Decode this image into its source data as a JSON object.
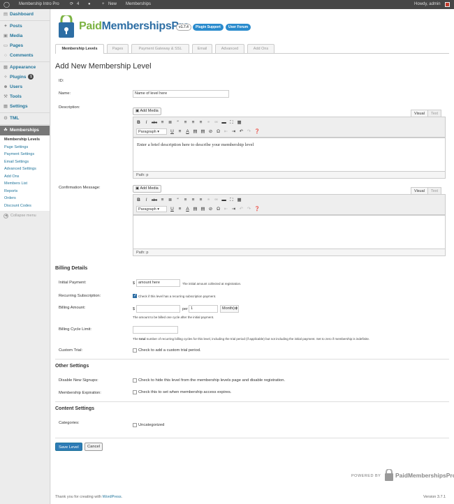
{
  "admin_bar": {
    "site_name": "Membership Intro Pro",
    "updates_count": "4",
    "new_label": "New",
    "memberships_label": "Memberships",
    "howdy": "Howdy, admin"
  },
  "sidebar": {
    "items": [
      {
        "label": "Dashboard",
        "icon": "dashboard-icon"
      },
      {
        "label": "Posts",
        "icon": "pin-icon"
      },
      {
        "label": "Media",
        "icon": "media-icon"
      },
      {
        "label": "Pages",
        "icon": "page-icon"
      },
      {
        "label": "Comments",
        "icon": "comment-icon"
      },
      {
        "label": "Appearance",
        "icon": "appearance-icon"
      },
      {
        "label": "Plugins",
        "icon": "plugin-icon",
        "badge": "1"
      },
      {
        "label": "Users",
        "icon": "users-icon"
      },
      {
        "label": "Tools",
        "icon": "tools-icon"
      },
      {
        "label": "Settings",
        "icon": "settings-icon"
      },
      {
        "label": "TML",
        "icon": "tml-icon"
      },
      {
        "label": "Memberships",
        "icon": "memberships-icon"
      }
    ],
    "sub_items": [
      "Membership Levels",
      "Page Settings",
      "Payment Settings",
      "Email Settings",
      "Advanced Settings",
      "Add Ons",
      "Members List",
      "Reports",
      "Orders",
      "Discount Codes"
    ],
    "collapse_label": "Collapse menu"
  },
  "brand": {
    "logo_text": "PaidMembershipsPro",
    "version": "v1.7.4",
    "support_label": "Plugin Support",
    "forum_label": "User Forum"
  },
  "tabs": [
    "Membership Levels",
    "Pages",
    "Payment Gateway & SSL",
    "Email",
    "Advanced",
    "Add Ons"
  ],
  "page_title": "Add New Membership Level",
  "fields": {
    "id_label": "ID:",
    "name_label": "Name:",
    "name_placeholder": "Name of level here",
    "description_label": "Description:",
    "add_media": "Add Media",
    "visual_tab": "Visual",
    "text_tab": "Text",
    "format_select": "Paragraph",
    "description_text": "Enter a brief description here to describe your membership level",
    "path_label": "Path: p",
    "confirmation_label": "Confirmation Message:"
  },
  "billing": {
    "heading": "Billing Details",
    "initial_payment_label": "Initial Payment:",
    "currency": "$",
    "initial_payment_value": "amount here",
    "initial_payment_hint": "The initial amount collected at registration.",
    "recurring_label": "Recurring Subscription:",
    "recurring_checked": true,
    "recurring_text": "Check if this level has a recurring subscription payment.",
    "billing_amount_label": "Billing Amount:",
    "per_label": "per",
    "cycle_number": "1",
    "period_select": "Month(s)",
    "billing_amount_hint": "The amount to be billed one cycle after the initial payment.",
    "cycle_limit_label": "Billing Cycle Limit:",
    "cycle_limit_hint_pre": "The ",
    "cycle_limit_hint_bold": "total",
    "cycle_limit_hint_post": " number of recurring billing cycles for this level, including the trial period (if applicable) but not including the initial payment. Set to zero if membership is indefinite.",
    "custom_trial_label": "Custom Trial:",
    "custom_trial_text": "Check to add a custom trial period."
  },
  "other": {
    "heading": "Other Settings",
    "disable_label": "Disable New Signups:",
    "disable_text": "Check to hide this level from the membership levels page and disable registration.",
    "expiration_label": "Membership Expiration:",
    "expiration_text": "Check this to set when membership access expires."
  },
  "content": {
    "heading": "Content Settings",
    "categories_label": "Categories:",
    "category_option": "Uncategorized"
  },
  "actions": {
    "save": "Save Level",
    "cancel": "Cancel"
  },
  "footer": {
    "powered_by": "POWERED BY",
    "powered_brand": "PaidMembershipsPro",
    "thanks_pre": "Thank you for creating with ",
    "thanks_link": "WordPress",
    "thanks_post": ".",
    "version": "Version 3.7.1"
  },
  "colors": {
    "admin_bar": "#464646",
    "link": "#21759b",
    "brand_green": "#7cb342",
    "brand_blue": "#2d6ea4",
    "pill_blue": "#2a8bcd",
    "active_menu": "#777777",
    "save_button": "#2e7bb6"
  }
}
